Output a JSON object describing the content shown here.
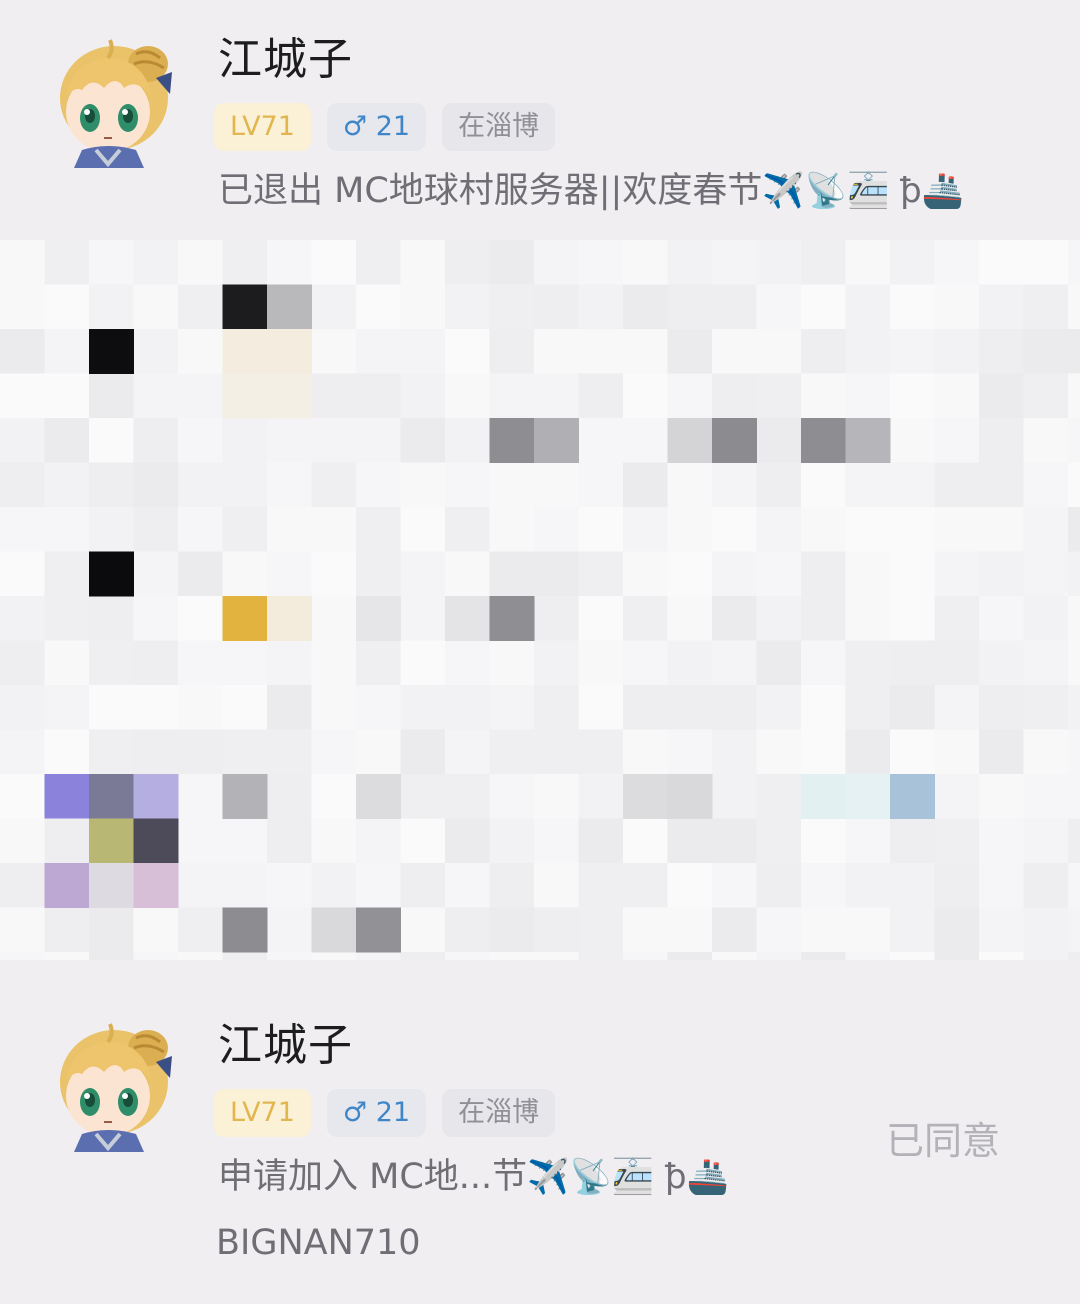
{
  "entries": [
    {
      "name": "江城子",
      "tags": {
        "level": "LV71",
        "gender_symbol": "♂",
        "age": "21",
        "city": "在淄博"
      },
      "message_text": "已退出 MC地球村服务器||欢度春节",
      "message_emojis": "✈️📡🚈 ꝥ🚢"
    },
    {
      "name": "江城子",
      "tags": {
        "level": "LV71",
        "gender_symbol": "♂",
        "age": "21",
        "city": "在淄博"
      },
      "message_text": "申请加入 MC地...节",
      "message_emojis": "✈️📡🚈 ꝥ🚢",
      "reason": "BIGNAN710",
      "status": "已同意"
    }
  ],
  "colors": {
    "background": "#f0eef1",
    "level_tag_bg": "#fbf1d6",
    "level_tag_text": "#e2b64f",
    "gender_tag_text": "#3f86c8",
    "city_tag_text": "#8f8f96",
    "status_text": "#b2b2b8"
  },
  "icons": {
    "avatar": "anime-girl-avatar",
    "gender": "male-symbol"
  }
}
